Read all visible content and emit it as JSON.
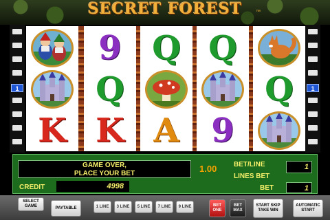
{
  "game": {
    "title": "SECRET FOREST",
    "trademark": "™"
  },
  "side_indicators": {
    "left_line": "1",
    "right_line": "1"
  },
  "reels": [
    [
      "gnomes",
      "castle",
      "K"
    ],
    [
      "9",
      "Q",
      "K"
    ],
    [
      "Q",
      "mushroom",
      "A"
    ],
    [
      "Q",
      "castle",
      "9"
    ],
    [
      "fox",
      "Q",
      "castle"
    ]
  ],
  "panel": {
    "message_line1": "GAME OVER,",
    "message_line2": "PLACE YOUR BET",
    "bet_per_line_value": "1.00",
    "bet_line_label": "BET/LINE",
    "lines_bet_label": "LINES BET",
    "bet_label": "BET",
    "bet_line_box": "1",
    "bet_box": "1",
    "credit_label": "CREDIT",
    "credit_value": "4998"
  },
  "buttons": {
    "select_game": "SELECT GAME",
    "paytable": "PAYTABLE",
    "line1": "1 LINE",
    "line3": "3 LINE",
    "line5": "5 LINE",
    "line7": "7 LINE",
    "line9": "9 LINE",
    "bet_one": "BET ONE",
    "bet_max": "BET MAX",
    "start": "START SKIP TAKE WIN",
    "auto_start": "AUTOMATIC START"
  },
  "colors": {
    "panel_green": "#1d6c1d",
    "text_yellow": "#f7f06a",
    "title_gold": "#f2b23a",
    "line_indicator_blue": "#1f56d6"
  }
}
